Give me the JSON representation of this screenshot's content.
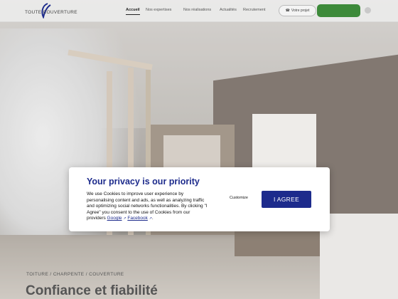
{
  "header": {
    "logo_text": "TOUTE COUVERTURE",
    "nav": [
      {
        "label": "Accueil"
      },
      {
        "label": "Nos expertises"
      },
      {
        "label": "Nos réalisations"
      },
      {
        "label": "Actualités"
      },
      {
        "label": "Recrutement"
      }
    ],
    "pill_label": "Votre projet",
    "icons": {
      "pill": "phone-icon",
      "right": "menu-icon"
    },
    "colors": {
      "green_button": "#3d8a3a"
    }
  },
  "hero": {
    "breadcrumb": "TOITURE / CHARPENTE / COUVERTURE",
    "title": "Confiance et fiabilité"
  },
  "cookie_modal": {
    "title": "Your privacy is our priority",
    "body_text": "We use Cookies to improve user experience by personalising content and ads, as well as analyzing traffic and optimizing social networks functionalities. By clicking \"I Agree\" you consent to the use of Cookies from our providers",
    "link_google": "Google",
    "link_facebook": "Facebook",
    "ext_icon": "↗",
    "customize_label": "Customize",
    "agree_label": "I AGREE",
    "colors": {
      "accent": "#1d2b8c"
    }
  }
}
